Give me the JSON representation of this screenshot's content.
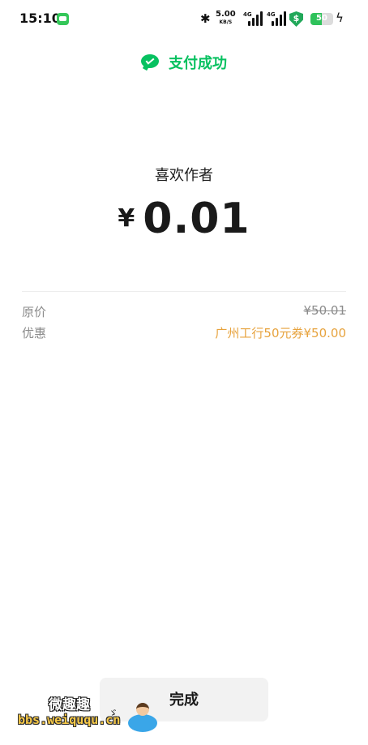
{
  "status_bar": {
    "time": "15:10",
    "net_speed_value": "5.00",
    "net_speed_unit": "KB/S",
    "signal_1_label": "4G",
    "signal_2_label": "4G",
    "security_badge": "$",
    "battery_level": "50",
    "battery_fraction": 0.5,
    "icons": [
      "message-icon",
      "bluetooth-icon",
      "signal-icon",
      "shield-icon",
      "battery-icon",
      "charging-icon"
    ]
  },
  "header": {
    "status_text": "支付成功",
    "icon": "wechat-pay-icon",
    "accent_color": "#07c160"
  },
  "payment": {
    "merchant": "喜欢作者",
    "currency_symbol": "¥",
    "amount": "0.01"
  },
  "details": [
    {
      "label": "原价",
      "value": "¥50.01"
    },
    {
      "label": "优惠",
      "value": "广州工行50元券¥50.00"
    }
  ],
  "colors": {
    "discount": "#e7a33e",
    "muted": "#8c8c8c"
  },
  "actions": {
    "done_label": "完成"
  },
  "watermark": {
    "title": "微趣趣",
    "url": "bbs.weiququ.cn"
  }
}
